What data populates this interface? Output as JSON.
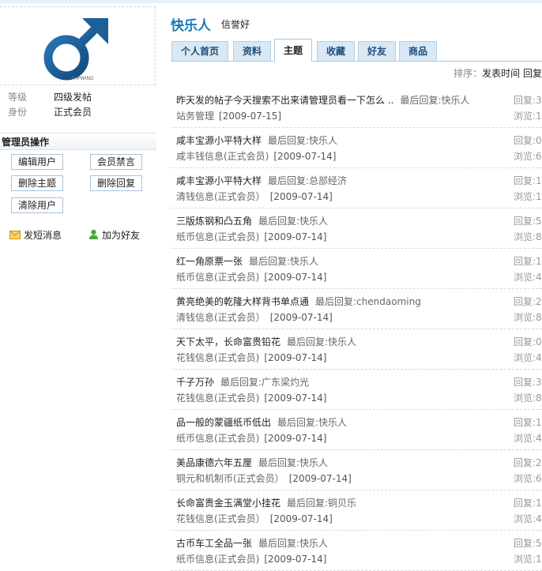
{
  "profile": {
    "logo_text": "PHPWIND",
    "level_label": "等级",
    "level_value": "四级发帖",
    "identity_label": "身份",
    "identity_value": "正式会员"
  },
  "admin": {
    "title": "管理员操作",
    "buttons": [
      "编辑用户",
      "会员禁言",
      "删除主题",
      "删除回复",
      "清除用户"
    ]
  },
  "actions": {
    "send_message": "发短消息",
    "add_friend": "加为好友"
  },
  "user": {
    "name": "快乐人",
    "reputation": "信誉好"
  },
  "tabs": [
    {
      "label": "个人首页",
      "active": false
    },
    {
      "label": "资料",
      "active": false
    },
    {
      "label": "主题",
      "active": true
    },
    {
      "label": "收藏",
      "active": false
    },
    {
      "label": "好友",
      "active": false
    },
    {
      "label": "商品",
      "active": false
    }
  ],
  "sort": {
    "label": "排序：",
    "options": "发表时间  回复"
  },
  "posts": [
    {
      "title": "昨天发的帖子今天搜索不出来请管理员看一下怎么 ..",
      "last_reply": "最后回复:快乐人",
      "board": "站务管理",
      "date": "[2009-07-15]",
      "reply_stat": "回复:3",
      "view_stat": "浏览:1"
    },
    {
      "title": "咸丰宝源小平特大样",
      "last_reply": "最后回复:快乐人",
      "board": "咸丰钱信息(正式会员)",
      "date": "[2009-07-14]",
      "reply_stat": "回复:0",
      "view_stat": "浏览:6"
    },
    {
      "title": "咸丰宝源小平特大样",
      "last_reply": "最后回复:总部经济",
      "board": "清钱信息(正式会员）",
      "date": "[2009-07-14]",
      "reply_stat": "回复:1",
      "view_stat": "浏览:1"
    },
    {
      "title": "三版炼钢和凸五角",
      "last_reply": "最后回复:快乐人",
      "board": "纸币信息(正式会员)",
      "date": "[2009-07-14]",
      "reply_stat": "回复:5",
      "view_stat": "浏览:8"
    },
    {
      "title": "红一角原票一张",
      "last_reply": "最后回复:快乐人",
      "board": "纸币信息(正式会员)",
      "date": "[2009-07-14]",
      "reply_stat": "回复:1",
      "view_stat": "浏览:4"
    },
    {
      "title": "黄亮绝美的乾隆大样背书单点通",
      "last_reply": "最后回复:chendaoming",
      "board": "清钱信息(正式会员）",
      "date": "[2009-07-14]",
      "reply_stat": "回复:2",
      "view_stat": "浏览:8"
    },
    {
      "title": "天下太平，长命富贵铅花",
      "last_reply": "最后回复:快乐人",
      "board": "花钱信息(正式会员)",
      "date": "[2009-07-14]",
      "reply_stat": "回复:0",
      "view_stat": "浏览:4"
    },
    {
      "title": "千子万孙",
      "last_reply": "最后回复:广东梁灼光",
      "board": "花钱信息(正式会员)",
      "date": "[2009-07-14]",
      "reply_stat": "回复:3",
      "view_stat": "浏览:8"
    },
    {
      "title": "品一般的蒙疆纸币低出",
      "last_reply": "最后回复:快乐人",
      "board": "纸币信息(正式会员)",
      "date": "[2009-07-14]",
      "reply_stat": "回复:1",
      "view_stat": "浏览:4"
    },
    {
      "title": "美品康德六年五厘",
      "last_reply": "最后回复:快乐人",
      "board": "铜元和机制币(正式会员）",
      "date": "[2009-07-14]",
      "reply_stat": "回复:2",
      "view_stat": "浏览:6"
    },
    {
      "title": "长命富贵金玉满堂小挂花",
      "last_reply": "最后回复:铜贝乐",
      "board": "花钱信息(正式会员）",
      "date": "[2009-07-14]",
      "reply_stat": "回复:1",
      "view_stat": "浏览:4"
    },
    {
      "title": "古币车工全品一张",
      "last_reply": "最后回复:快乐人",
      "board": "纸币信息(正式会员)",
      "date": "[2009-07-14]",
      "reply_stat": "回复:5",
      "view_stat": "浏览:1"
    }
  ]
}
